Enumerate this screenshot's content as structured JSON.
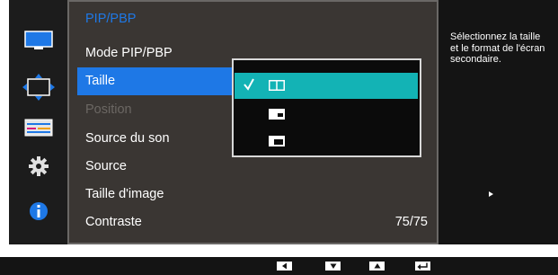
{
  "icons": {
    "sidebar": [
      "monitor-icon",
      "move-arrows-icon",
      "pip-layout-icon",
      "gear-icon",
      "info-icon"
    ],
    "keys": [
      "left-key-icon",
      "down-key-icon",
      "up-key-icon",
      "enter-key-icon"
    ],
    "submenu": [
      "pip-side-by-side-icon",
      "pip-small-window-icon",
      "pip-large-window-icon"
    ],
    "check": "checkmark-icon"
  },
  "colors": {
    "accent": "#1e78e6",
    "submenu_selected": "#13b3b5",
    "panel": "#3a3633",
    "disabled_text": "#6b6763"
  },
  "menu": {
    "header": "PIP/PBP",
    "items": [
      {
        "label": "Mode PIP/PBP",
        "value": ""
      },
      {
        "label": "Taille",
        "value": ""
      },
      {
        "label": "Position",
        "value": ""
      },
      {
        "label": "Source du son",
        "value": ""
      },
      {
        "label": "Source",
        "value": ""
      },
      {
        "label": "Taille d'image",
        "value": ""
      },
      {
        "label": "Contraste",
        "value": "75/75"
      }
    ]
  },
  "help": {
    "line1": "Sélectionnez la taille",
    "line2": "et le format de l'écran",
    "line3": "secondaire."
  }
}
